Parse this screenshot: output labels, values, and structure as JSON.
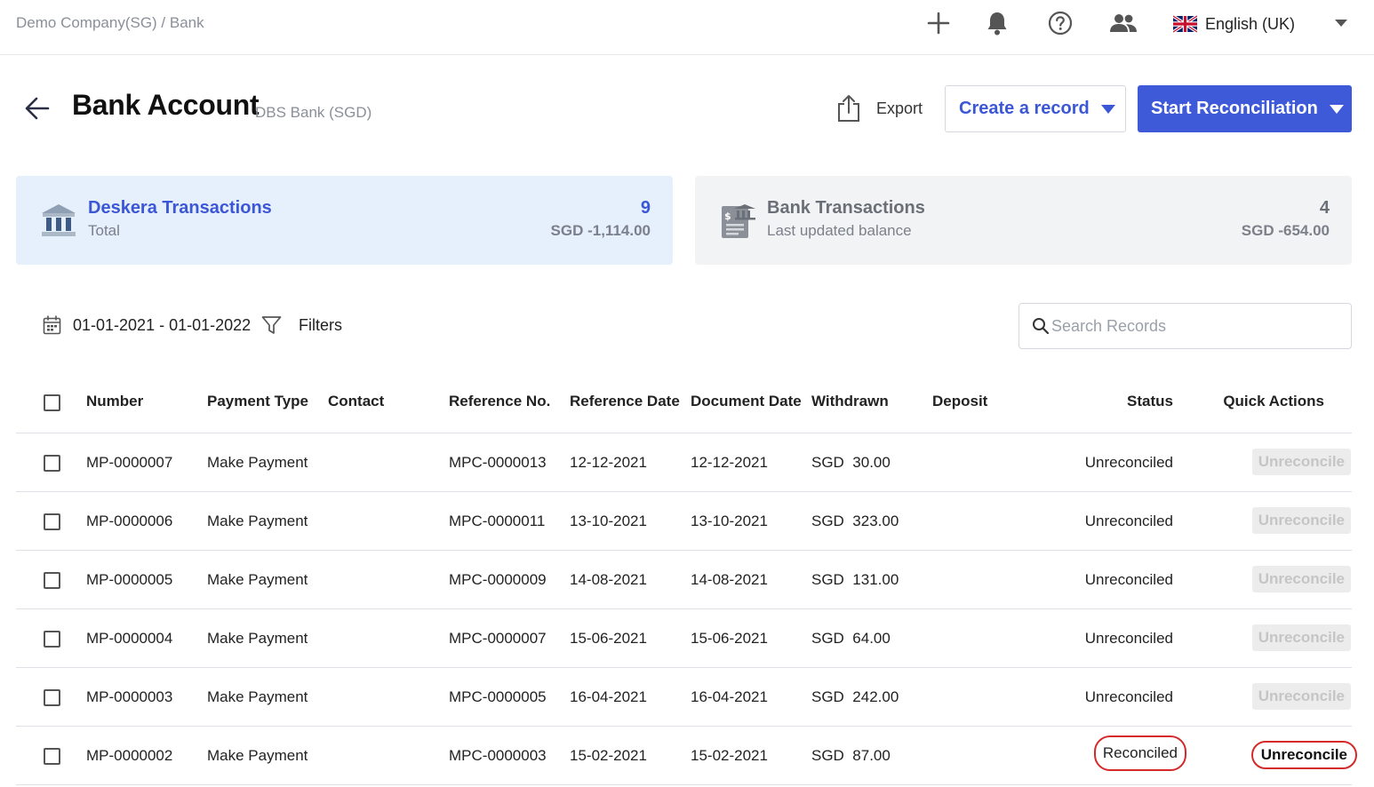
{
  "breadcrumb": "Demo Company(SG) / Bank",
  "language": "English (UK)",
  "page": {
    "title": "Bank Account",
    "subtitle": "DBS Bank (SGD)"
  },
  "actions": {
    "export_label": "Export",
    "create_label": "Create a record",
    "start_label": "Start Reconciliation"
  },
  "cards": {
    "deskera": {
      "title": "Deskera Transactions",
      "subtitle": "Total",
      "count": "9",
      "amount": "SGD -1,114.00"
    },
    "bank": {
      "title": "Bank Transactions",
      "subtitle": "Last updated balance",
      "count": "4",
      "amount": "SGD -654.00"
    }
  },
  "filters": {
    "date_range": "01-01-2021 - 01-01-2022",
    "filters_label": "Filters",
    "search_placeholder": "Search Records"
  },
  "table": {
    "columns": {
      "number": "Number",
      "payment_type": "Payment Type",
      "contact": "Contact",
      "reference_no": "Reference No.",
      "reference_date": "Reference Date",
      "document_date": "Document Date",
      "withdrawn": "Withdrawn",
      "deposit": "Deposit",
      "status": "Status",
      "quick_actions": "Quick Actions"
    },
    "rows": [
      {
        "number": "MP-0000007",
        "payment_type": "Make Payment",
        "contact": "",
        "reference_no": "MPC-0000013",
        "reference_date": "12-12-2021",
        "document_date": "12-12-2021",
        "withdrawn": "SGD  30.00",
        "deposit": "",
        "status": "Unreconciled",
        "action": "Unreconcile"
      },
      {
        "number": "MP-0000006",
        "payment_type": "Make Payment",
        "contact": "",
        "reference_no": "MPC-0000011",
        "reference_date": "13-10-2021",
        "document_date": "13-10-2021",
        "withdrawn": "SGD  323.00",
        "deposit": "",
        "status": "Unreconciled",
        "action": "Unreconcile"
      },
      {
        "number": "MP-0000005",
        "payment_type": "Make Payment",
        "contact": "",
        "reference_no": "MPC-0000009",
        "reference_date": "14-08-2021",
        "document_date": "14-08-2021",
        "withdrawn": "SGD  131.00",
        "deposit": "",
        "status": "Unreconciled",
        "action": "Unreconcile"
      },
      {
        "number": "MP-0000004",
        "payment_type": "Make Payment",
        "contact": "",
        "reference_no": "MPC-0000007",
        "reference_date": "15-06-2021",
        "document_date": "15-06-2021",
        "withdrawn": "SGD  64.00",
        "deposit": "",
        "status": "Unreconciled",
        "action": "Unreconcile"
      },
      {
        "number": "MP-0000003",
        "payment_type": "Make Payment",
        "contact": "",
        "reference_no": "MPC-0000005",
        "reference_date": "16-04-2021",
        "document_date": "16-04-2021",
        "withdrawn": "SGD  242.00",
        "deposit": "",
        "status": "Unreconciled",
        "action": "Unreconcile"
      },
      {
        "number": "MP-0000002",
        "payment_type": "Make Payment",
        "contact": "",
        "reference_no": "MPC-0000003",
        "reference_date": "15-02-2021",
        "document_date": "15-02-2021",
        "withdrawn": "SGD  87.00",
        "deposit": "",
        "status": "Reconciled",
        "action": "Unreconcile"
      }
    ]
  },
  "icons": {
    "add": "plus-icon",
    "notifications": "bell-icon",
    "help": "question-circle-icon",
    "users": "users-icon",
    "language_flag": "uk-flag-icon",
    "back": "arrow-left-icon",
    "export": "share-upload-icon",
    "calendar": "calendar-icon",
    "filter": "funnel-icon",
    "search": "search-icon"
  },
  "colors": {
    "accent": "#3f5ad8",
    "deskera_card_bg": "#e6effc",
    "bank_card_bg": "#f2f3f5",
    "highlight_ring": "#d42a2a"
  }
}
